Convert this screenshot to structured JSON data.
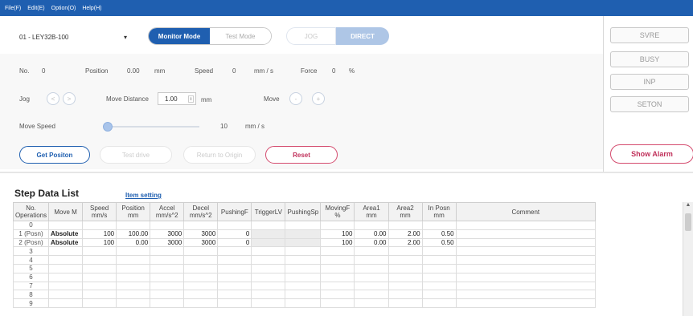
{
  "menu": [
    "File(F)",
    "Edit(E)",
    "Option(O)",
    "Help(H)"
  ],
  "axis": {
    "value": "01 - LEY32B-100",
    "arrow": "▾"
  },
  "modes": {
    "monitor": "Monitor Mode",
    "test": "Test Mode"
  },
  "jog_direct": {
    "jog": "JOG",
    "direct": "DIRECT"
  },
  "readout": {
    "no_label": "No.",
    "no_value": "0",
    "position_label": "Position",
    "position_value": "0.00",
    "position_unit": "mm",
    "speed_label": "Speed",
    "speed_value": "0",
    "speed_unit": "mm / s",
    "force_label": "Force",
    "force_value": "0",
    "force_unit": "%"
  },
  "jog_row": {
    "jog_label": "Jog",
    "prev": "<",
    "next": ">",
    "move_distance_label": "Move Distance",
    "move_distance_value": "1.00",
    "move_distance_unit": "mm",
    "move_label": "Move",
    "minus": "-",
    "plus": "+"
  },
  "move_speed": {
    "label": "Move Speed",
    "value": "10",
    "unit": "mm / s"
  },
  "actions": {
    "get_position": "Get Positon",
    "test_drive": "Test drive",
    "return_origin": "Return to Origin",
    "reset": "Reset"
  },
  "status": {
    "svre": "SVRE",
    "busy": "BUSY",
    "inp": "INP",
    "seton": "SETON",
    "show_alarm": "Show Alarm"
  },
  "step_data": {
    "title": "Step Data List",
    "item_setting": "Item setting",
    "headers": [
      [
        "No.",
        "Operations"
      ],
      [
        "Move M",
        ""
      ],
      [
        "Speed",
        "mm/s"
      ],
      [
        "Position",
        "mm"
      ],
      [
        "Accel",
        "mm/s^2"
      ],
      [
        "Decel",
        "mm/s^2"
      ],
      [
        "PushingF",
        ""
      ],
      [
        "TriggerLV",
        ""
      ],
      [
        "PushingSp",
        ""
      ],
      [
        "MovingF",
        "%"
      ],
      [
        "Area1",
        "mm"
      ],
      [
        "Area2",
        "mm"
      ],
      [
        "In Posn",
        "mm"
      ],
      [
        "Comment",
        ""
      ]
    ],
    "rows": [
      [
        "0",
        "",
        "",
        "",
        "",
        "",
        "",
        "",
        "",
        "",
        "",
        "",
        "",
        ""
      ],
      [
        "1 (Posn)",
        "Absolute",
        "100",
        "100.00",
        "3000",
        "3000",
        "0",
        "",
        "",
        "100",
        "0.00",
        "2.00",
        "0.50",
        ""
      ],
      [
        "2 (Posn)",
        "Absolute",
        "100",
        "0.00",
        "3000",
        "3000",
        "0",
        "",
        "",
        "100",
        "0.00",
        "2.00",
        "0.50",
        ""
      ],
      [
        "3",
        "",
        "",
        "",
        "",
        "",
        "",
        "",
        "",
        "",
        "",
        "",
        "",
        ""
      ],
      [
        "4",
        "",
        "",
        "",
        "",
        "",
        "",
        "",
        "",
        "",
        "",
        "",
        "",
        ""
      ],
      [
        "5",
        "",
        "",
        "",
        "",
        "",
        "",
        "",
        "",
        "",
        "",
        "",
        "",
        ""
      ],
      [
        "6",
        "",
        "",
        "",
        "",
        "",
        "",
        "",
        "",
        "",
        "",
        "",
        "",
        ""
      ],
      [
        "7",
        "",
        "",
        "",
        "",
        "",
        "",
        "",
        "",
        "",
        "",
        "",
        "",
        ""
      ],
      [
        "8",
        "",
        "",
        "",
        "",
        "",
        "",
        "",
        "",
        "",
        "",
        "",
        "",
        ""
      ],
      [
        "9",
        "",
        "",
        "",
        "",
        "",
        "",
        "",
        "",
        "",
        "",
        "",
        "",
        ""
      ]
    ]
  },
  "scroll": {
    "up": "▲"
  }
}
